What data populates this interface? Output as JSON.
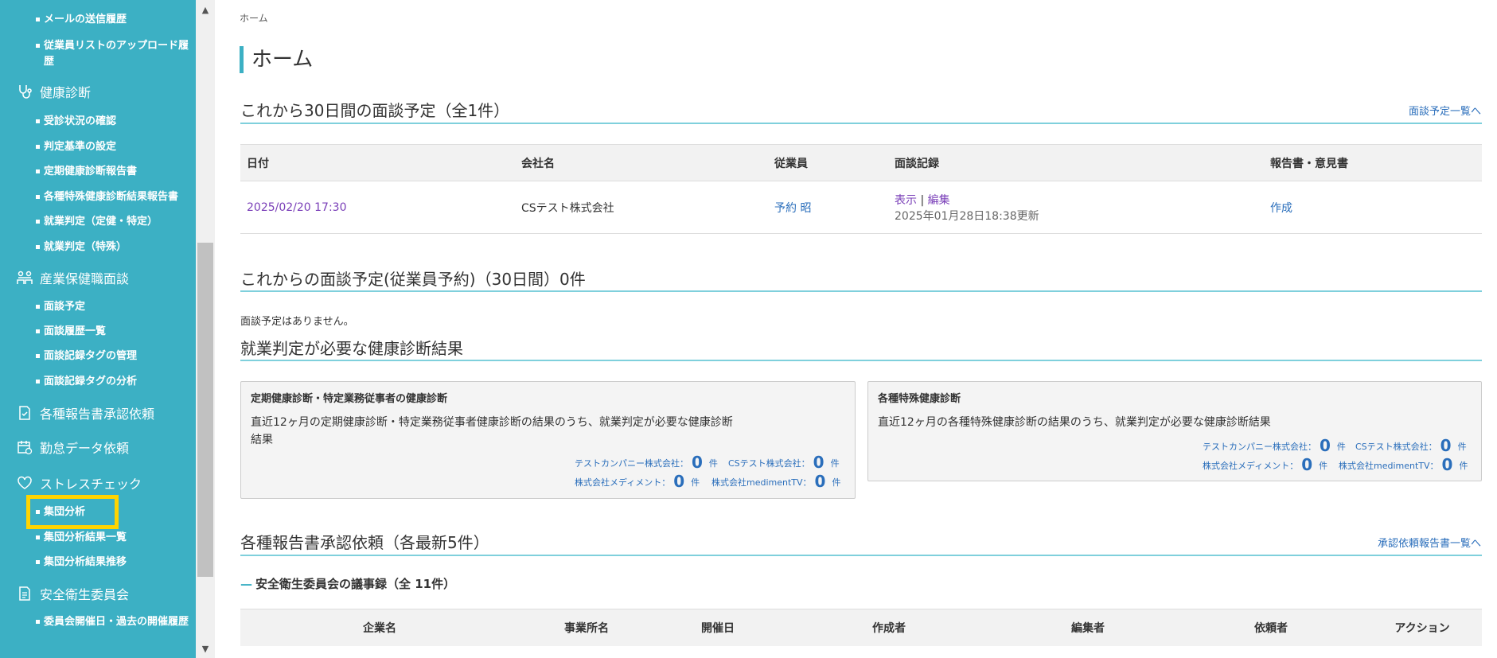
{
  "sidebar": {
    "top_items": [
      "メールの送信履歴",
      "従業員リストのアップロード履歴"
    ],
    "health_check": {
      "label": "健康診断",
      "items": [
        "受診状況の確認",
        "判定基準の設定",
        "定期健康診断報告書",
        "各種特殊健康診断結果報告書",
        "就業判定（定健・特定）",
        "就業判定（特殊）"
      ]
    },
    "interview": {
      "label": "産業保健職面談",
      "items": [
        "面談予定",
        "面談履歴一覧",
        "面談記録タグの管理",
        "面談記録タグの分析"
      ]
    },
    "report_approval": {
      "label": "各種報告書承認依頼"
    },
    "attendance": {
      "label": "勤怠データ依頼"
    },
    "stress_check": {
      "label": "ストレスチェック",
      "items": [
        "集団分析",
        "集団分析結果一覧",
        "集団分析結果推移"
      ]
    },
    "committee": {
      "label": "安全衛生委員会",
      "items": [
        "委員会開催日・過去の開催履歴"
      ]
    }
  },
  "breadcrumb": "ホーム",
  "page_title": "ホーム",
  "upcoming": {
    "title": "これから30日間の面談予定（全1件）",
    "link": "面談予定一覧へ",
    "headers": [
      "日付",
      "会社名",
      "従業員",
      "面談記録",
      "報告書・意見書"
    ],
    "row": {
      "date": "2025/02/20 17:30",
      "company": "CSテスト株式会社",
      "employee": "予約 昭",
      "view": "表示",
      "sep": "|",
      "edit": "編集",
      "updated": "2025年01月28日18:38更新",
      "report": "作成"
    }
  },
  "employee_booking": {
    "title": "これからの面談予定(従業員予約)（30日間）0件",
    "empty": "面談予定はありません。"
  },
  "judgment": {
    "title": "就業判定が必要な健康診断結果",
    "cards": [
      {
        "title": "定期健康診断・特定業務従事者の健康診断",
        "desc1": "直近12ヶ月の定期健康診断・特定業務従事者健康診断の結果のうち、就業判定が必要な健康診断",
        "desc2": "結果",
        "stats": [
          {
            "label": "テストカンパニー株式会社：",
            "num": "0",
            "unit": "件"
          },
          {
            "label": "CSテスト株式会社：",
            "num": "0",
            "unit": "件"
          },
          {
            "label": "株式会社メディメント：",
            "num": "0",
            "unit": "件"
          },
          {
            "label": "株式会社medimentTV：",
            "num": "0",
            "unit": "件"
          }
        ]
      },
      {
        "title": "各種特殊健康診断",
        "desc1": "直近12ヶ月の各種特殊健康診断の結果のうち、就業判定が必要な健康診断結果",
        "desc2": "",
        "stats": [
          {
            "label": "テストカンパニー株式会社：",
            "num": "0",
            "unit": "件"
          },
          {
            "label": "CSテスト株式会社：",
            "num": "0",
            "unit": "件"
          },
          {
            "label": "株式会社メディメント：",
            "num": "0",
            "unit": "件"
          },
          {
            "label": "株式会社medimentTV：",
            "num": "0",
            "unit": "件"
          }
        ]
      }
    ]
  },
  "approvals": {
    "title": "各種報告書承認依頼（各最新5件）",
    "link": "承認依頼報告書一覧へ",
    "sub_title": "安全衛生委員会の議事録（全 11件）",
    "headers": [
      "企業名",
      "事業所名",
      "開催日",
      "作成者",
      "編集者",
      "依頼者",
      "アクション"
    ]
  },
  "colors": {
    "sidebar": "#3cb0c4",
    "accent_line": "#7fd0dc",
    "highlight": "#ffd400",
    "link": "#2a6ebb",
    "purple": "#7a3fb8"
  }
}
